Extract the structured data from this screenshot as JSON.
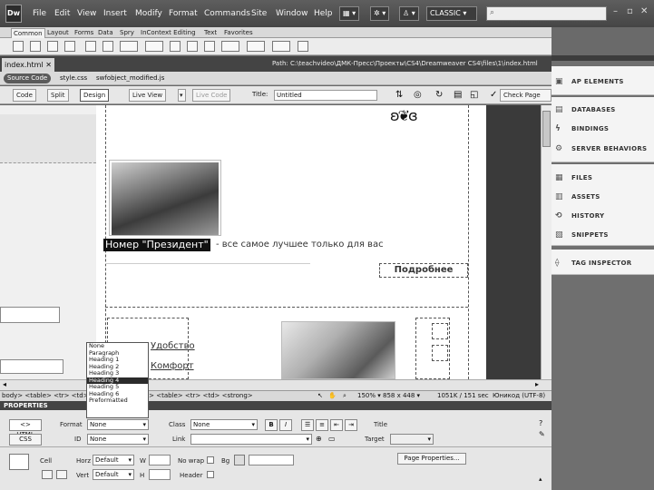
{
  "app": {
    "logo": "Dw"
  },
  "menu": [
    "File",
    "Edit",
    "View",
    "Insert",
    "Modify",
    "Format",
    "Commands",
    "Site",
    "Window",
    "Help"
  ],
  "workspace": {
    "mode": "CLASSIC"
  },
  "insert_tabs": [
    "Common",
    "Layout",
    "Forms",
    "Data",
    "Spry",
    "InContext Editing",
    "Text",
    "Favorites"
  ],
  "document": {
    "tabs": [
      {
        "label": "index.html"
      }
    ],
    "path": "Path:  C:\\teachvideo\\ДМК-Пресс\\Проекты\\CS4\\Dreamweaver CS4\\files\\1\\index.html",
    "source_code": "Source Code",
    "related_files": [
      "style.css",
      "swfobject_modified.js"
    ]
  },
  "doc_toolbar": {
    "code": "Code",
    "split": "Split",
    "design": "Design",
    "live_view": "Live View",
    "live_code": "Live Code",
    "title_label": "Title:",
    "title_value": "Untitled",
    "check_page": "Check Page"
  },
  "design_view": {
    "headline": "Номер \"Президент\"",
    "headline_rest": " - все самое лучшее только для вас",
    "more_button": "Подробнее",
    "links": [
      "Удобство",
      "Комфорт"
    ]
  },
  "format_dropdown": {
    "options": [
      "None",
      "Paragraph",
      "Heading 1",
      "Heading 2",
      "Heading 3",
      "Heading 4",
      "Heading 5",
      "Heading 6",
      "Preformatted"
    ],
    "highlighted": "Heading 4"
  },
  "tag_selector": {
    "path": "body> <table> <tr> <td> <table> <tr> <td> <table> <tr> <td> <strong>",
    "zoom": "150%",
    "size": "858 x 448",
    "weight": "1051K / 151 sec",
    "encoding": "Юникод (UTF-8)"
  },
  "properties": {
    "title": "PROPERTIES",
    "html_btn": "<> HTML",
    "css_btn": "CSS",
    "format_label": "Format",
    "format_value": "None",
    "id_label": "ID",
    "id_value": "None",
    "class_label": "Class",
    "class_value": "None",
    "link_label": "Link",
    "title_label": "Title",
    "target_label": "Target",
    "bold": "B",
    "italic": "I",
    "cell_label": "Cell",
    "horz_label": "Horz",
    "horz_value": "Default",
    "vert_label": "Vert",
    "vert_value": "Default",
    "w_label": "W",
    "h_label": "H",
    "nowrap_label": "No wrap",
    "bg_label": "Bg",
    "header_label": "Header",
    "page_props": "Page Properties..."
  },
  "panels": {
    "group1": [
      "AP ELEMENTS"
    ],
    "group2": [
      "DATABASES",
      "BINDINGS",
      "SERVER BEHAVIORS"
    ],
    "group3": [
      "FILES",
      "ASSETS",
      "HISTORY",
      "SNIPPETS"
    ],
    "group4": [
      "TAG INSPECTOR"
    ]
  }
}
